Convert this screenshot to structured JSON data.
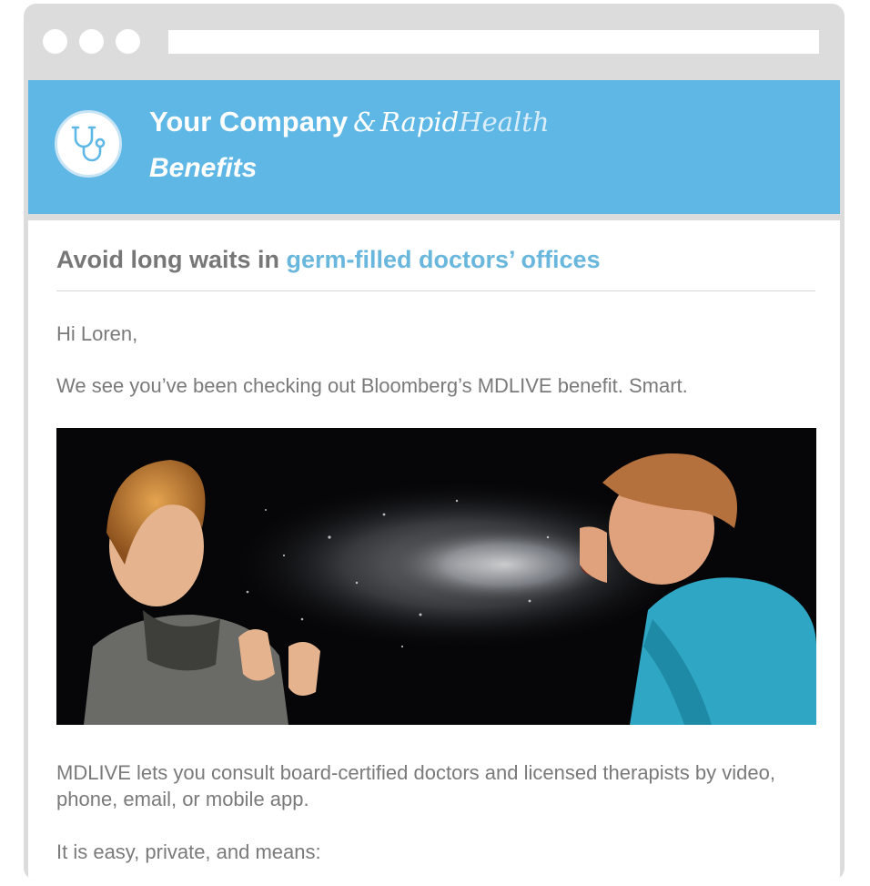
{
  "window": {
    "controls": [
      "close",
      "minimize",
      "maximize"
    ],
    "address_bar": ""
  },
  "banner": {
    "logo_icon": "stethoscope-icon",
    "company": "Your Company",
    "ampersand": "&",
    "partner_first": "Rapid",
    "partner_second": "Health",
    "subtitle": "Benefits",
    "background_color": "#5fb7e6"
  },
  "email": {
    "headline_lead": "Avoid long waits in ",
    "headline_accent": "germ-filled doctors’ offices",
    "greeting": "Hi Loren,",
    "intro": "We see you’ve been checking out Bloomberg’s MDLIVE benefit. Smart.",
    "image_icon": "sneeze-photo",
    "body_1": "MDLIVE lets you consult board-certified doctors and licensed therapists by video, phone, email, or mobile app.",
    "body_2": "It is easy, private, and means:"
  },
  "colors": {
    "accent": "#6ab7de",
    "text": "#7a7a7a"
  }
}
